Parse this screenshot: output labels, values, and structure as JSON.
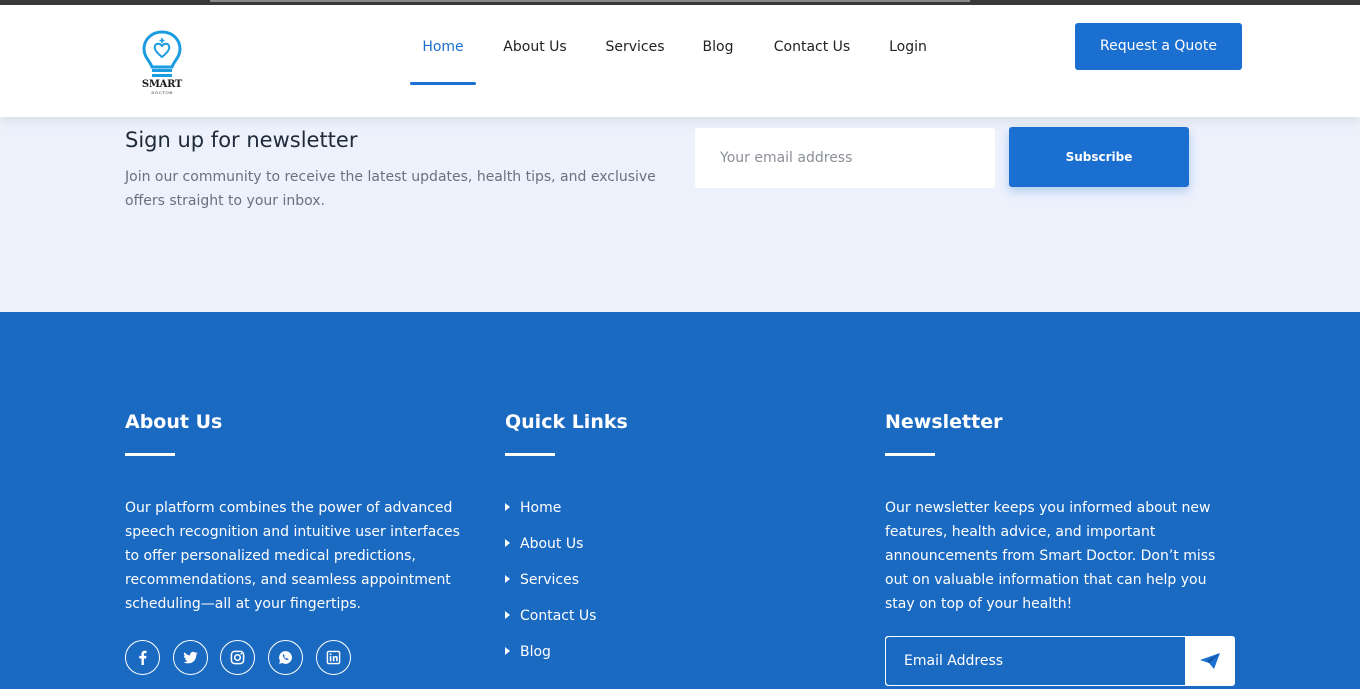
{
  "colors": {
    "accent": "#1b6fd1",
    "footer_bg": "#1b6ac2",
    "band_bg": "#edf1fc"
  },
  "logo": {
    "text": "SMART",
    "subtext": "DOCTOR"
  },
  "nav": {
    "items": [
      {
        "label": "Home",
        "active": true
      },
      {
        "label": "About Us"
      },
      {
        "label": "Services"
      },
      {
        "label": "Blog"
      },
      {
        "label": "Contact Us"
      },
      {
        "label": "Login"
      }
    ],
    "cta": "Request a Quote"
  },
  "signup": {
    "title": "Sign up for newsletter",
    "description": "Join our community to receive the latest updates, health tips, and exclusive offers straight to your inbox.",
    "email_placeholder": "Your email address",
    "button": "Subscribe"
  },
  "footer": {
    "about": {
      "title": "About Us",
      "text": "Our platform combines the power of advanced speech recognition and intuitive user interfaces to offer personalized medical predictions, recommendations, and seamless appointment scheduling—all at your fingertips.",
      "social": [
        "facebook-icon",
        "twitter-icon",
        "instagram-icon",
        "whatsapp-icon",
        "linkedin-icon"
      ]
    },
    "quick_links": {
      "title": "Quick Links",
      "items": [
        "Home",
        "About Us",
        "Services",
        "Contact Us",
        "Blog"
      ]
    },
    "newsletter": {
      "title": "Newsletter",
      "text": "Our newsletter keeps you informed about new features, health advice, and important announcements from Smart Doctor. Don’t miss out on valuable information that can help you stay on top of your health!",
      "email_placeholder": "Email Address"
    }
  }
}
